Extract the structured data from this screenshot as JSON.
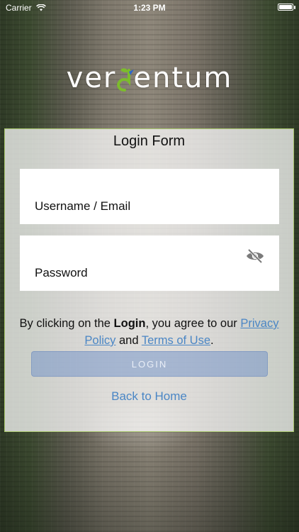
{
  "status_bar": {
    "carrier": "Carrier",
    "time": "1:23 PM"
  },
  "logo": {
    "text_left": "ver",
    "text_right": "entum"
  },
  "login_form": {
    "title": "Login Form",
    "username_label": "Username / Email",
    "password_label": "Password",
    "consent": {
      "prefix": "By clicking on the ",
      "bold": "Login",
      "middle": ", you agree to our ",
      "privacy_link": "Privacy Policy",
      "and": " and ",
      "terms_link": "Terms of Use",
      "suffix": "."
    },
    "login_button": "LOGIN",
    "back_link": "Back to Home"
  },
  "colors": {
    "card_border": "#a7c56a",
    "link": "#4a86c5",
    "button_bg": "#7696c8",
    "logo_green": "#7cbc2c",
    "logo_blue": "#2f67c9"
  },
  "icons": [
    "wifi-icon",
    "battery-icon",
    "eye-slash-icon"
  ]
}
